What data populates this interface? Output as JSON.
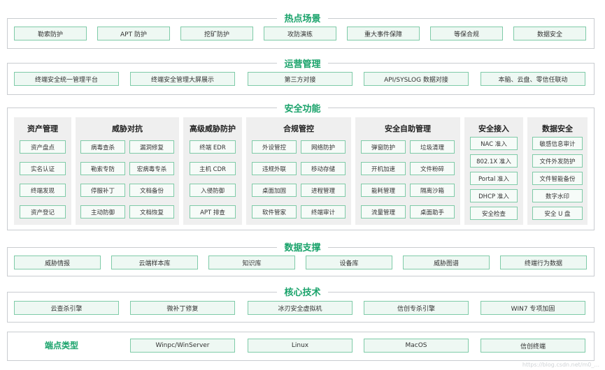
{
  "hotspot": {
    "title": "热点场景",
    "items": [
      "勒索防护",
      "APT 防护",
      "挖矿防护",
      "攻防演练",
      "重大事件保障",
      "等保合规",
      "数据安全"
    ]
  },
  "operations": {
    "title": "运营管理",
    "items": [
      "终端安全统一管理平台",
      "终端安全管理大屏展示",
      "第三方对接",
      "API/SYSLOG 数据对接",
      "本脑、云盘、零信任联动"
    ]
  },
  "security": {
    "title": "安全功能",
    "panels": [
      {
        "title": "资产管理",
        "items": [
          "资产盘点",
          "实名认证",
          "终端发现",
          "资产登记"
        ]
      },
      {
        "title": "威胁对抗",
        "items": [
          "病毒查杀",
          "漏洞修复",
          "勒索专防",
          "宏病毒专杀",
          "停服补丁",
          "文档备份",
          "主动防御",
          "文档恢复"
        ]
      },
      {
        "title": "高级威胁防护",
        "items": [
          "终端 EDR",
          "主机 CDR",
          "入侵防御",
          "APT 排查"
        ]
      },
      {
        "title": "合规管控",
        "items": [
          "外设管控",
          "网络防护",
          "违规外联",
          "移动存储",
          "桌面加固",
          "进程管理",
          "软件管家",
          "终端审计"
        ]
      },
      {
        "title": "安全自助管理",
        "items": [
          "弹窗防护",
          "垃圾清理",
          "开机加速",
          "文件粉碎",
          "能耗管理",
          "隔离沙箱",
          "流量管理",
          "桌面助手"
        ]
      },
      {
        "title": "安全接入",
        "items": [
          "NAC 准入",
          "802.1X 准入",
          "Portal 准入",
          "DHCP 准入",
          "安全检查"
        ]
      },
      {
        "title": "数据安全",
        "items": [
          "敏感信息审计",
          "文件外发防护",
          "文件智能备份",
          "数字水印",
          "安全 U 盘"
        ]
      }
    ]
  },
  "data_support": {
    "title": "数据支撑",
    "items": [
      "威胁情报",
      "云端样本库",
      "知识库",
      "设备库",
      "威胁图谱",
      "终端行为数据"
    ]
  },
  "core_tech": {
    "title": "核心技术",
    "items": [
      "云查杀引擎",
      "微补丁修复",
      "冰刃安全虚拟机",
      "信创专杀引擎",
      "WIN7 专项加固"
    ]
  },
  "endpoints": {
    "label": "端点类型",
    "items": [
      "Winpc/WinServer",
      "Linux",
      "MacOS",
      "信创终端"
    ]
  },
  "watermark": "https://blog.csdn.net/m0_..."
}
